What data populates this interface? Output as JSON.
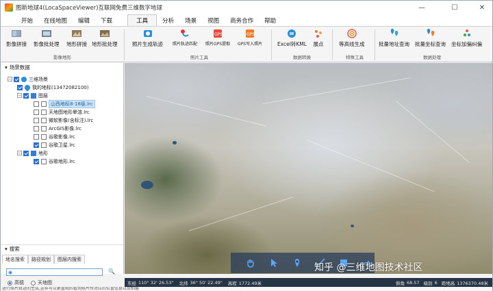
{
  "window": {
    "title": "图新地球4(LocaSpaceViewer)互联网免费三维数字地球",
    "minimize": "—",
    "maximize": "☐",
    "close": "✕"
  },
  "menu": {
    "tabs": [
      "开始",
      "在线地图",
      "编辑",
      "下载",
      "工具",
      "分析",
      "场景",
      "视图",
      "商务合作",
      "帮助"
    ],
    "active_index": 4
  },
  "ribbon": {
    "buttons": {
      "image_stitch": "影像拼接",
      "image_batch": "影像批处理",
      "terrain_stitch": "地形拼接",
      "terrain_batch": "地形批处理",
      "photo_track": "照片生成轨迹",
      "photo_track_match": "照片轨迹匹配",
      "photo_gps_extract": "照片GPS提取",
      "gps_write_photo": "GPS写入照片",
      "excel_to_kml": "Excel转KML",
      "show_points": "展点",
      "contour": "等高线生成",
      "batch_addr_query": "批量地址查询",
      "batch_coord_query": "批量坐标查询",
      "coord_correction": "坐标加偏纠偏"
    },
    "groups": {
      "image_terrain": "影像地形",
      "photo_tools": "照片工具",
      "data_convert": "数据转换",
      "special_tools": "特殊工具",
      "data_processing": "数据处理"
    }
  },
  "scene_panel": {
    "title": "场景数据",
    "tree": {
      "root": "三维场景",
      "my_places": "我的地标(13472082100)",
      "layers": "图层",
      "layer_items": [
        {
          "label": "山西地标8-18级.lrc",
          "checked": false,
          "selected": true
        },
        {
          "label": "天地图地形晕渲.lrc",
          "checked": false,
          "selected": false
        },
        {
          "label": "微软影像(含标注).lrc",
          "checked": false,
          "selected": false
        },
        {
          "label": "ArcGIS影像.lrc",
          "checked": false,
          "selected": false
        },
        {
          "label": "谷歌影像.lrc",
          "checked": false,
          "selected": false
        },
        {
          "label": "谷歌卫星.lrc",
          "checked": true,
          "selected": false
        }
      ],
      "terrain": "地形",
      "terrain_items": [
        {
          "label": "谷歌地形.lrc",
          "checked": true
        }
      ]
    }
  },
  "search_panel": {
    "title": "搜索",
    "tabs": [
      "地名搜索",
      "路径规划",
      "图层内搜索"
    ],
    "active_tab": 0,
    "input_value": "",
    "input_placeholder": "",
    "search_icon": "🔍",
    "sources": [
      "高德",
      "天地图"
    ],
    "selected_source": 0
  },
  "map_toolbar": {
    "tools": [
      "hand-icon",
      "pointer-icon",
      "location-pin-icon",
      "measure-line-icon",
      "square-icon",
      "arrow-icon"
    ]
  },
  "watermark": "知乎 @三维地图技术社区",
  "status": {
    "lon_label": "东经",
    "lon_value": "110° 32' 26.53\"",
    "lat_label": "北纬",
    "lat_value": "36° 50' 22.49\"",
    "elev_label": "高程",
    "elev_value": "1772.49米",
    "tilt_label": "俯角",
    "tilt_value": "68.57",
    "level_label": "级别",
    "level_value": "6",
    "dist_label": "距地高",
    "dist_value": "1376370.48米"
  },
  "bottom_text": "进行照片轨迹的生成,这样可以更直观的看到照片所对应的位置信息以及拍摄",
  "colors": {
    "accent": "#2a6fd6",
    "statusbar": "#263445",
    "toolbar": "#283c5a"
  }
}
